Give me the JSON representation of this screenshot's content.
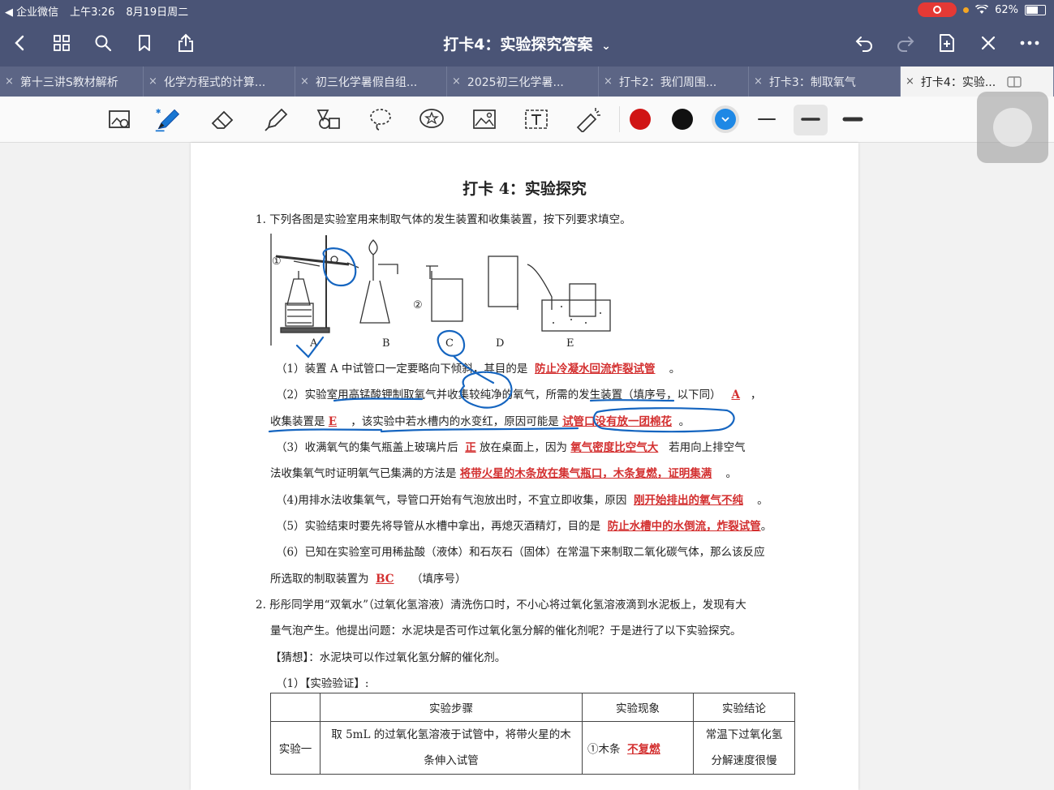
{
  "status": {
    "back_app": "◀ 企业微信",
    "time": "上午3:26",
    "date": "8月19日周二",
    "battery": "62%",
    "battery_level": 0.62
  },
  "toolbar": {
    "title": "打卡4：实验探究答案",
    "title_chevron": "⌄"
  },
  "tabs": [
    {
      "label": "第十三讲S教材解析"
    },
    {
      "label": "化学方程式的计算..."
    },
    {
      "label": "初三化学暑假自组..."
    },
    {
      "label": "2025初三化学暑..."
    },
    {
      "label": "打卡2：我们周围..."
    },
    {
      "label": "打卡3：制取氧气"
    },
    {
      "label": "打卡4：实验..."
    }
  ],
  "colors": {
    "bar": "#4a5476",
    "tab_bar": "#5c6585",
    "pen_red": "#d01515",
    "pen_black": "#111111",
    "pen_blue": "#1e88e5",
    "answer_red": "#d32f2f",
    "ink_blue": "#1565c0"
  },
  "doc": {
    "title": "打卡 4：实验探究",
    "q1": "1.  下列各图是实验室用来制取气体的发生装置和收集装置，按下列要求填空。",
    "apparatus_labels": [
      "A",
      "B",
      "C",
      "D",
      "E"
    ],
    "apparatus_marks": [
      "①",
      "②"
    ],
    "s1a": "（1）装置 A 中试管口一定要略向下倾斜，其目的是",
    "s1ans": "防止冷凝水回流炸裂试管",
    "s1b": "。",
    "s2a": "（2）实验室用高锰酸钾制取氧气并收集较纯净的氧气，所需的发生装置（填序号，以下同）",
    "s2ans": "A",
    "s2b": "，",
    "s2c": "收集装置是",
    "s2ans2": "E",
    "s2d": "，该实验中若水槽内的水变红，原因可能是",
    "s2ans3": "试管口没有放一团棉花",
    "s2e": "。",
    "s3a": "（3）收满氧气的集气瓶盖上玻璃片后",
    "s3ans": "正",
    "s3b": "放在桌面上，因为",
    "s3ans2": "氧气密度比空气大",
    "s3c": "若用向上排空气",
    "s3d": "法收集氧气时证明氧气已集满的方法是",
    "s3ans3": "将带火星的木条放在集气瓶口，木条复燃，证明集满",
    "s3e": "。",
    "s4a": "（4)用排水法收集氧气，导管口开始有气泡放出时，不宜立即收集，原因",
    "s4ans": "刚开始排出的氧气不纯",
    "s4b": "。",
    "s5a": "（5）实验结束时要先将导管从水槽中拿出，再熄灭酒精灯，目的是",
    "s5ans": "防止水槽中的水倒流，炸裂试管",
    "s5b": "。",
    "s6a": "（6）已知在实验室可用稀盐酸（液体）和石灰石（固体）在常温下来制取二氧化碳气体，那么该反应",
    "s6b": "所选取的制取装置为",
    "s6ans": "BC",
    "s6c": "（填序号）",
    "q2a": "2.  彤彤同学用“双氧水”（过氧化氢溶液）清洗伤口时，不小心将过氧化氢溶液滴到水泥板上，发现有大",
    "q2b": "量气泡产生。他提出问题：水泥块是否可作过氧化氢分解的催化剂呢？于是进行了以下实验探究。",
    "guess": "【猜想】：水泥块可以作过氧化氢分解的催化剂。",
    "verify": "（1）【实验验证】:",
    "table": {
      "headers": [
        "",
        "实验步骤",
        "实验现象",
        "实验结论"
      ],
      "row1": {
        "name": "实验一",
        "step1": "取 5mL 的过氧化氢溶液于试管中，将带火星的木",
        "step2": "条伸入试管",
        "obs_prefix": "①木条",
        "obs_ans": "不复燃",
        "concl1": "常温下过氧化氢",
        "concl2": "分解速度很慢"
      }
    }
  }
}
